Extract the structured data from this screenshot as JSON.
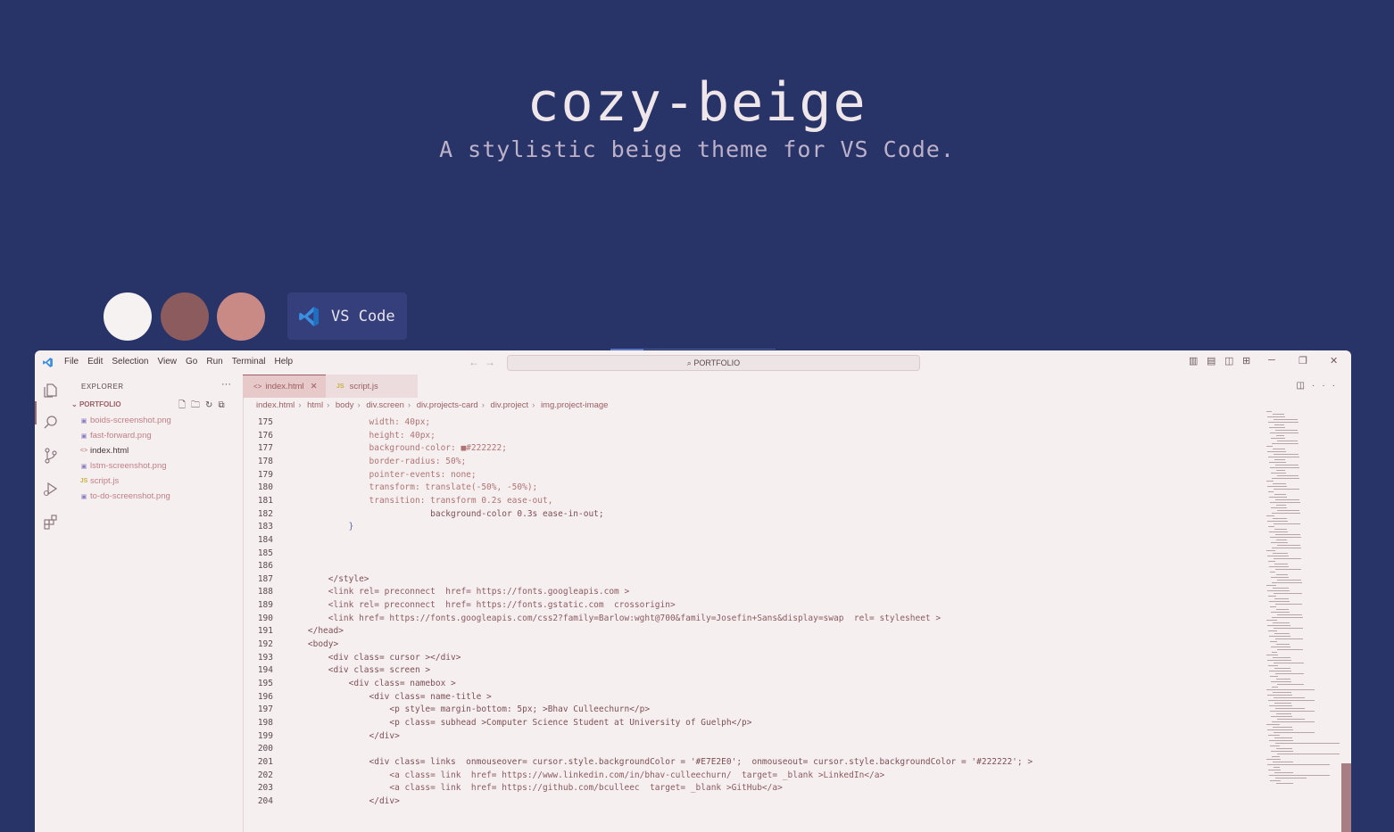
{
  "hero": {
    "title": "cozy-beige",
    "subtitle": "A stylistic beige theme for VS Code."
  },
  "swatches": [
    {
      "name": "white",
      "color": "#f6f2f2"
    },
    {
      "name": "brown",
      "color": "#8c5b5e"
    },
    {
      "name": "pink",
      "color": "#c98a86"
    }
  ],
  "vscode_button": {
    "label": "VS Code",
    "icon": "vscode-logo-icon"
  },
  "window": {
    "menu": [
      "File",
      "Edit",
      "Selection",
      "View",
      "Go",
      "Run",
      "Terminal",
      "Help"
    ],
    "command_center": "PORTFOLIO",
    "window_controls": [
      "minimize-icon",
      "restore-icon",
      "close-icon"
    ]
  },
  "explorer": {
    "header": "EXPLORER",
    "folder": "PORTFOLIO",
    "files": [
      {
        "name": "boids-screenshot.png",
        "icon": "image-file-icon"
      },
      {
        "name": "fast-forward.png",
        "icon": "image-file-icon"
      },
      {
        "name": "index.html",
        "icon": "html-file-icon"
      },
      {
        "name": "lstm-screenshot.png",
        "icon": "image-file-icon"
      },
      {
        "name": "script.js",
        "icon": "js-file-icon"
      },
      {
        "name": "to-do-screenshot.png",
        "icon": "image-file-icon"
      }
    ]
  },
  "tabs": [
    {
      "label": "index.html",
      "active": true
    },
    {
      "label": "script.js",
      "active": false
    }
  ],
  "breadcrumb": [
    "index.html",
    "html",
    "body",
    "div.screen",
    "div.projects-card",
    "div.project",
    "img.project-image"
  ],
  "editor": {
    "lines": [
      {
        "n": "175",
        "text": "                width: 40px;"
      },
      {
        "n": "176",
        "text": "                height: 40px;"
      },
      {
        "n": "177",
        "text": "                background-color: ■#222222;"
      },
      {
        "n": "178",
        "text": "                border-radius: 50%;"
      },
      {
        "n": "179",
        "text": "                pointer-events: none;"
      },
      {
        "n": "180",
        "text": "                transform: translate(-50%, -50%);"
      },
      {
        "n": "181",
        "text": "                transition: transform 0.2s ease-out,"
      },
      {
        "n": "182",
        "text": "                            background-color 0.3s ease-in-out;"
      },
      {
        "n": "183",
        "text": "            }"
      },
      {
        "n": "184",
        "text": ""
      },
      {
        "n": "185",
        "text": ""
      },
      {
        "n": "186",
        "text": ""
      },
      {
        "n": "187",
        "text": "        </style>"
      },
      {
        "n": "188",
        "text": "        <link rel= preconnect  href= https://fonts.googleapis.com >"
      },
      {
        "n": "189",
        "text": "        <link rel= preconnect  href= https://fonts.gstatic.com  crossorigin>"
      },
      {
        "n": "190",
        "text": "        <link href= https://fonts.googleapis.com/css2?family=Barlow:wght@700&family=Josefin+Sans&display=swap  rel= stylesheet >"
      },
      {
        "n": "191",
        "text": "    </head>"
      },
      {
        "n": "192",
        "text": "    <body>"
      },
      {
        "n": "193",
        "text": "        <div class= cursor ></div>"
      },
      {
        "n": "194",
        "text": "        <div class= screen >"
      },
      {
        "n": "195",
        "text": "            <div class= namebox >"
      },
      {
        "n": "196",
        "text": "                <div class= name-title >"
      },
      {
        "n": "197",
        "text": "                    <p style= margin-bottom: 5px; >Bhav Culleechurn</p>"
      },
      {
        "n": "198",
        "text": "                    <p class= subhead >Computer Science Student at University of Guelph</p>"
      },
      {
        "n": "199",
        "text": "                </div>"
      },
      {
        "n": "200",
        "text": ""
      },
      {
        "n": "201",
        "text": "                <div class= links  onmouseover= cursor.style.backgroundColor = '#E7E2E0';  onmouseout= cursor.style.backgroundColor = '#222222'; >"
      },
      {
        "n": "202",
        "text": "                    <a class= link  href= https://www.linkedin.com/in/bhav-culleechurn/  target= _blank >LinkedIn</a>"
      },
      {
        "n": "203",
        "text": "                    <a class= link  href= https://github.com/bculleec  target= _blank >GitHub</a>"
      },
      {
        "n": "204",
        "text": "                </div>"
      }
    ]
  },
  "colors": {
    "background": "#283368",
    "window": "#f6eff0",
    "accent": "#9b5e62"
  }
}
